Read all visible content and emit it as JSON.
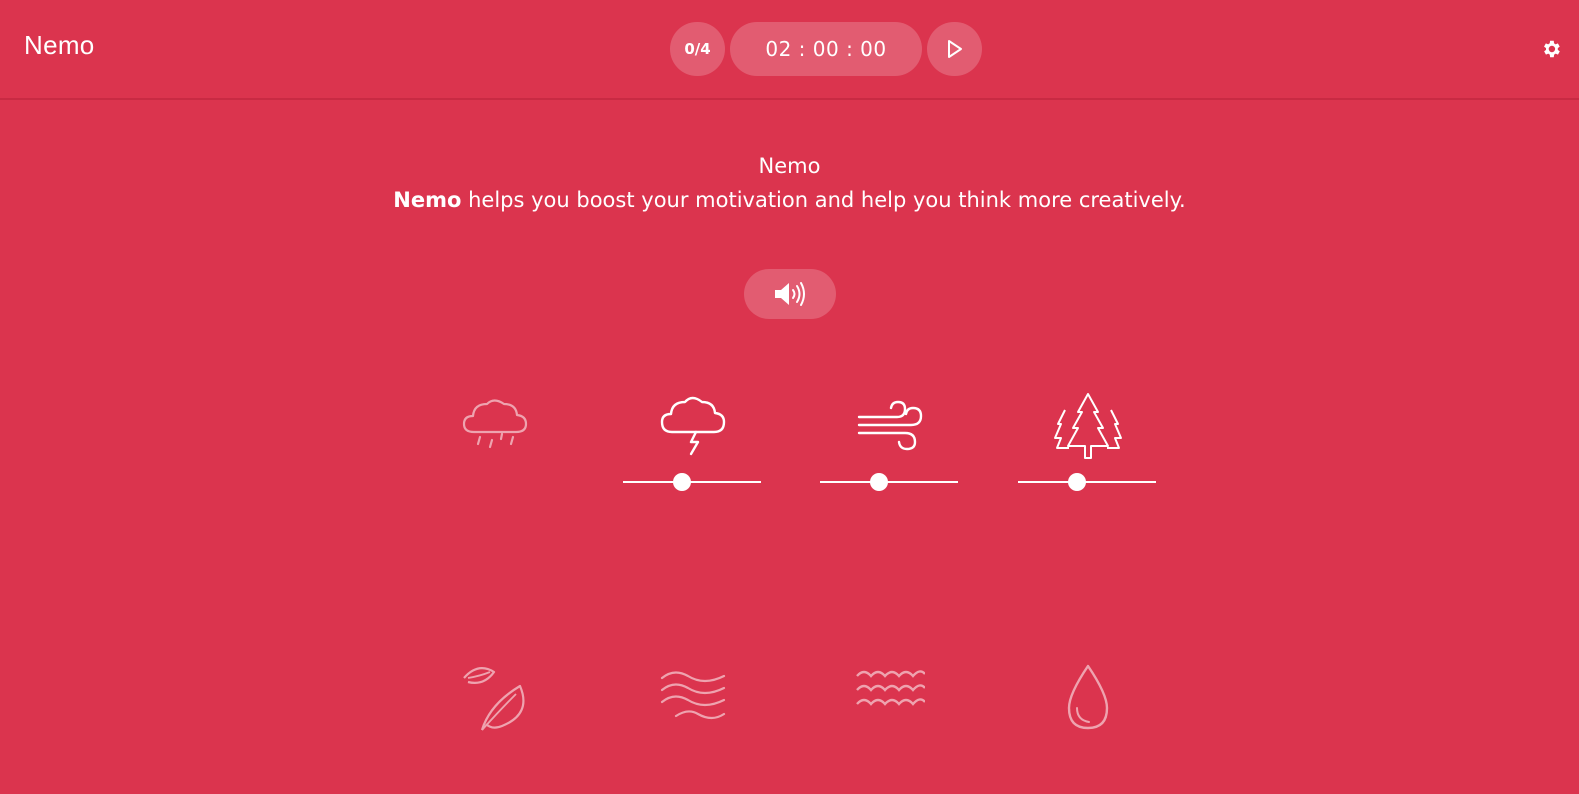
{
  "app": {
    "name": "Nemo"
  },
  "toolbar": {
    "counter": "0/4",
    "timer": "02 : 00 : 00"
  },
  "intro": {
    "title": "Nemo",
    "brand": "Nemo",
    "description": " helps you boost your motivation and help you think more creatively."
  },
  "colors": {
    "background": "#db344e",
    "foreground": "#ffffff"
  },
  "sounds": [
    {
      "name": "rain",
      "icon": "rain-cloud-icon",
      "active": false
    },
    {
      "name": "thunderstorm",
      "icon": "thunderstorm-icon",
      "active": true,
      "volume": 0.43
    },
    {
      "name": "wind",
      "icon": "wind-icon",
      "active": true,
      "volume": 0.43
    },
    {
      "name": "forest",
      "icon": "forest-icon",
      "active": true,
      "volume": 0.43
    },
    {
      "name": "leaves",
      "icon": "leaf-icon",
      "active": false
    },
    {
      "name": "waves",
      "icon": "waves-icon",
      "active": false
    },
    {
      "name": "water",
      "icon": "water-waves-icon",
      "active": false
    },
    {
      "name": "drop",
      "icon": "water-drop-icon",
      "active": false
    }
  ]
}
